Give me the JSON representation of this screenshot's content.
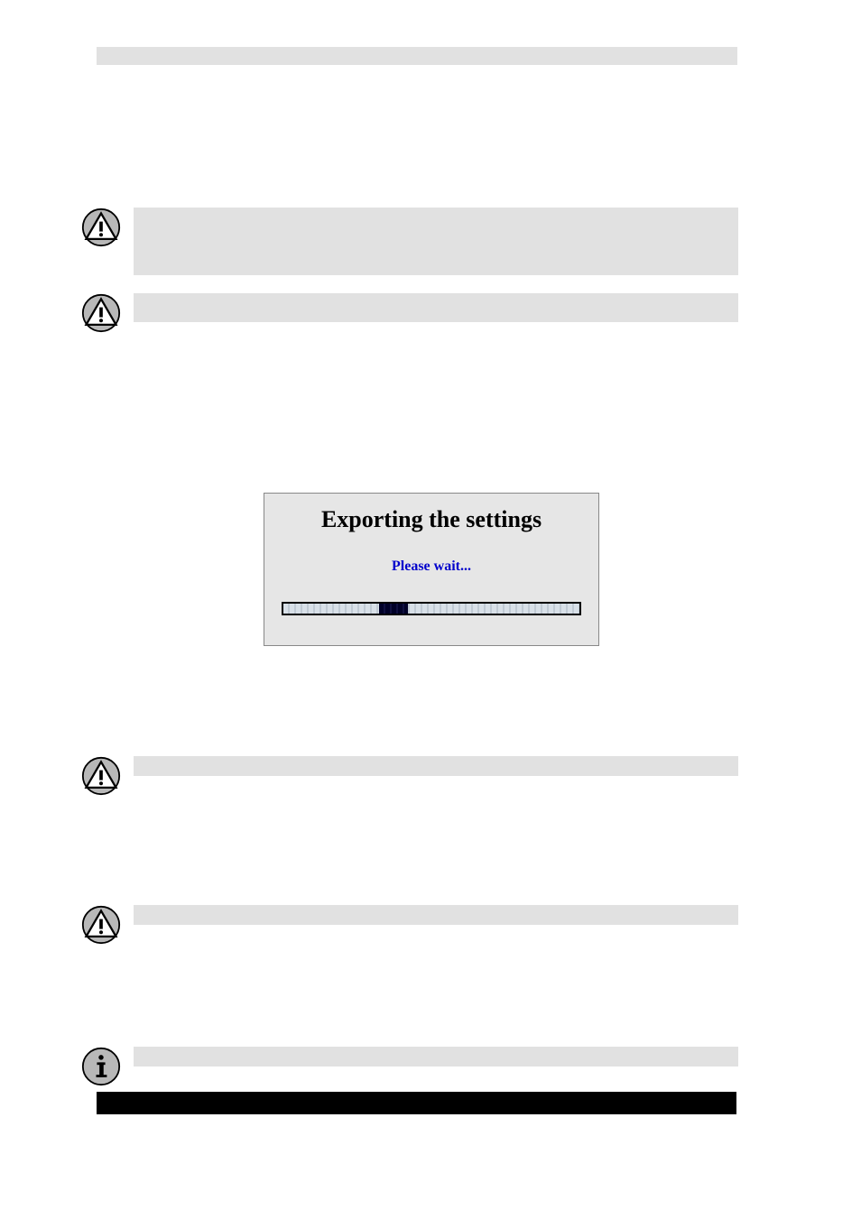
{
  "dialog": {
    "title": "Exporting the settings",
    "subtitle": "Please wait..."
  }
}
